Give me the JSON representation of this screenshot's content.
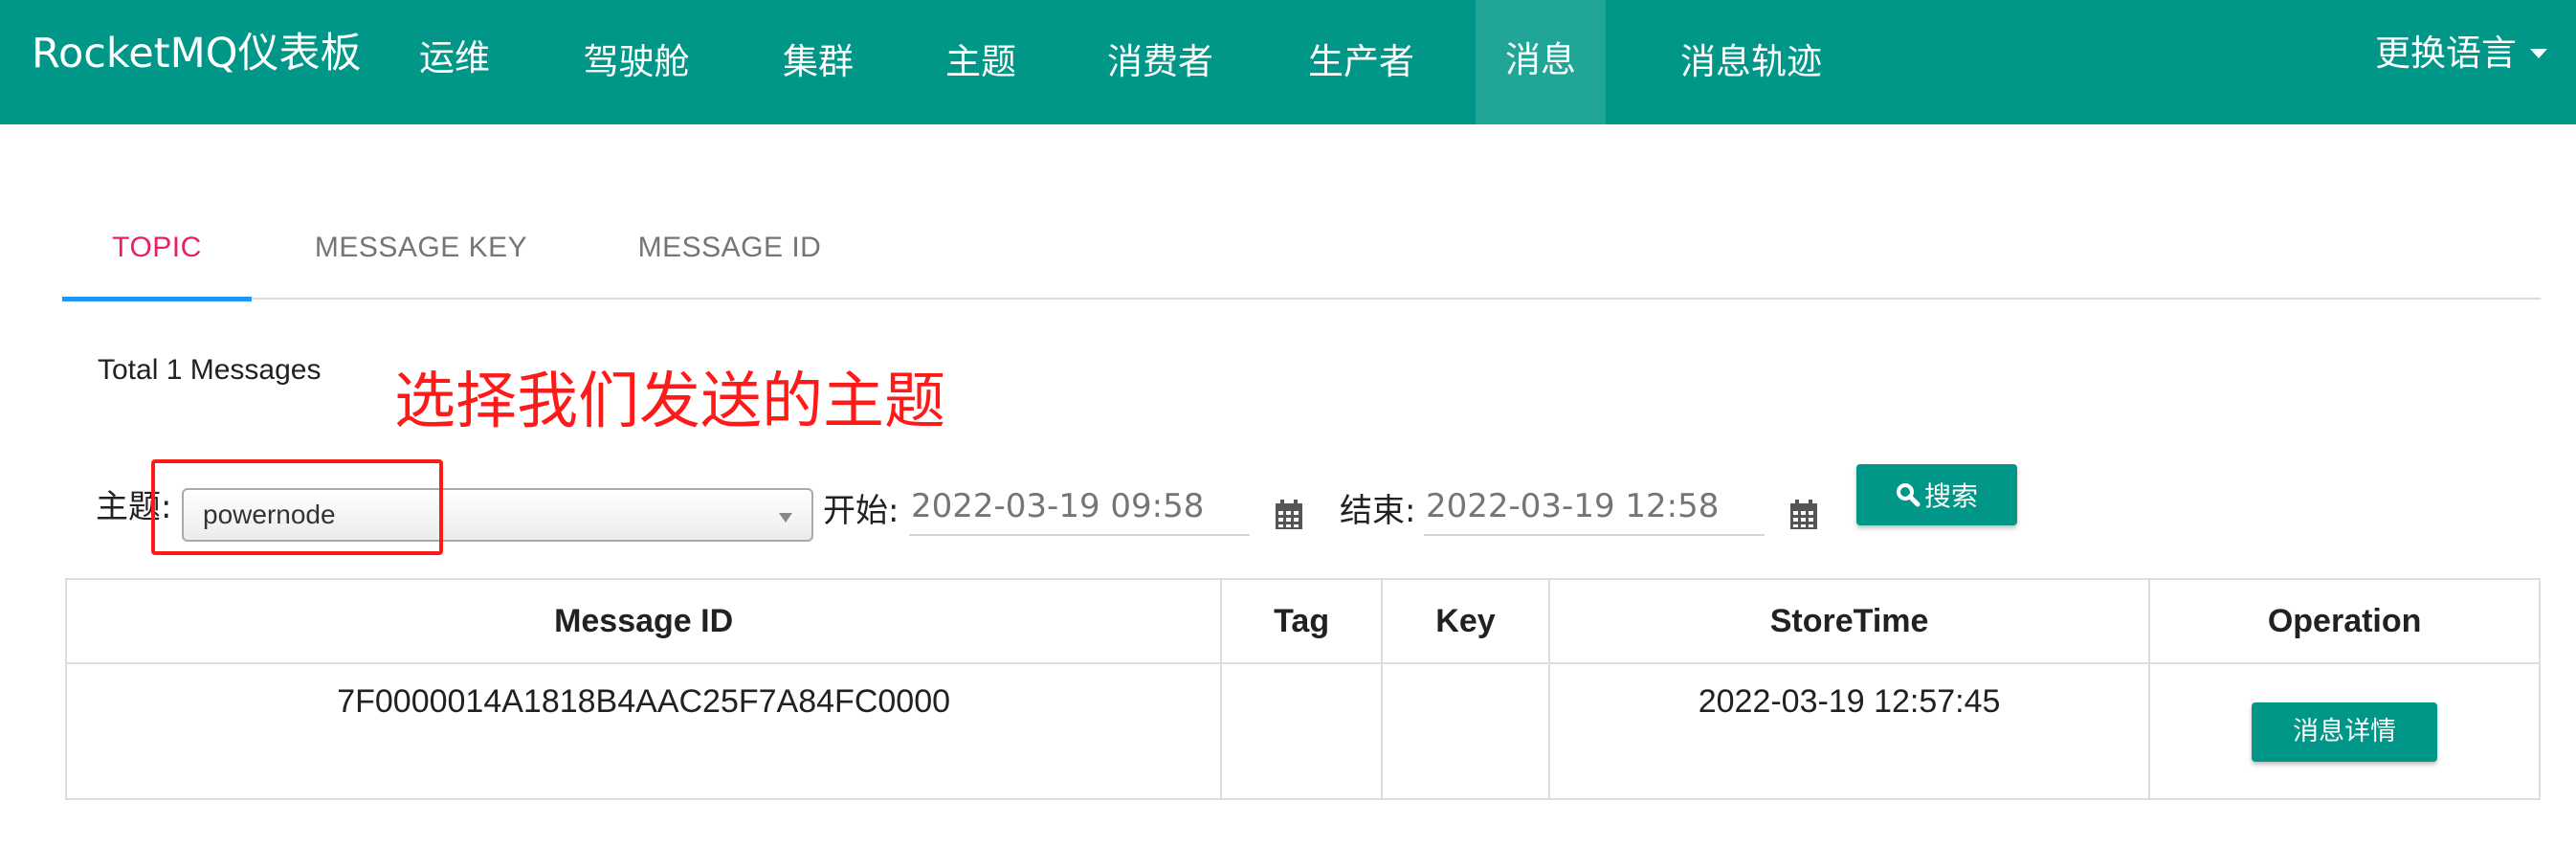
{
  "navbar": {
    "brand": "RocketMQ仪表板",
    "items": [
      {
        "label": "运维"
      },
      {
        "label": "驾驶舱"
      },
      {
        "label": "集群"
      },
      {
        "label": "主题"
      },
      {
        "label": "消费者"
      },
      {
        "label": "生产者"
      },
      {
        "label": "消息"
      },
      {
        "label": "消息轨迹"
      }
    ],
    "active": "消息",
    "language_label": "更换语言"
  },
  "tabs": [
    {
      "label": "TOPIC"
    },
    {
      "label": "MESSAGE KEY"
    },
    {
      "label": "MESSAGE ID"
    }
  ],
  "active_tab": "TOPIC",
  "summary": {
    "total_text": "Total 1 Messages"
  },
  "annotation": {
    "text": "选择我们发送的主题"
  },
  "search": {
    "topic_label": "主题:",
    "topic_value": "powernode",
    "start_label": "开始:",
    "start_value": "2022-03-19 09:58",
    "end_label": "结束:",
    "end_value": "2022-03-19 12:58",
    "search_button": "搜索",
    "search_icon": "magnifier-icon",
    "calendar_icon": "calendar-icon"
  },
  "table": {
    "headers": [
      "Message ID",
      "Tag",
      "Key",
      "StoreTime",
      "Operation"
    ],
    "rows": [
      {
        "message_id": "7F0000014A1818B4AAC25F7A84FC0000",
        "tag": "",
        "key": "",
        "store_time": "2022-03-19 12:57:45",
        "operation_label": "消息详情"
      }
    ]
  },
  "colors": {
    "primary": "#009688",
    "nav_active": "#20a597",
    "tab_active_text": "#e91e63",
    "tab_indicator": "#2196f3",
    "annotation": "#ff1a1a"
  }
}
